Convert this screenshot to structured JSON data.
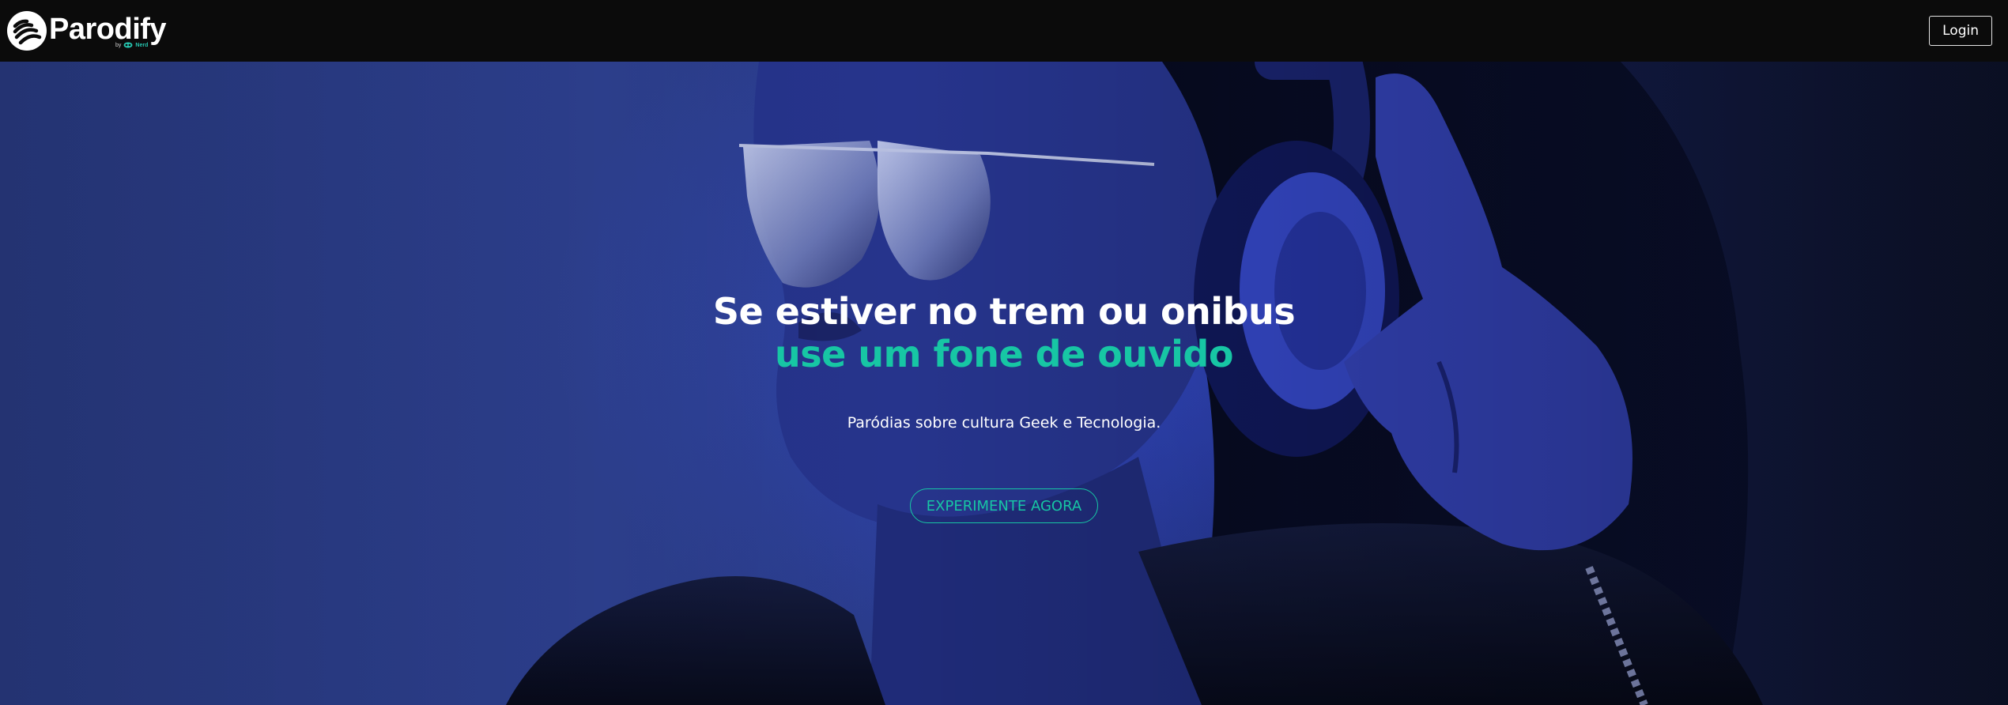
{
  "header": {
    "brand_name": "Parodify",
    "brand_byline_prefix": "by",
    "brand_byline_maker": "Nerd",
    "logo_icon": "parodify-logo-icon",
    "login_label": "Login"
  },
  "hero": {
    "headline_line1": "Se estiver no trem ou onibus",
    "headline_line2": "use um fone de ouvido",
    "subtitle": "Paródias sobre cultura Geek e Tecnologia.",
    "cta_label": "EXPERIMENTE AGORA",
    "background_image": "woman-with-headphones-photo"
  },
  "colors": {
    "accent": "#17c6a4",
    "topbar": "#0b0b0b",
    "hero_blue": "#2e4192"
  }
}
